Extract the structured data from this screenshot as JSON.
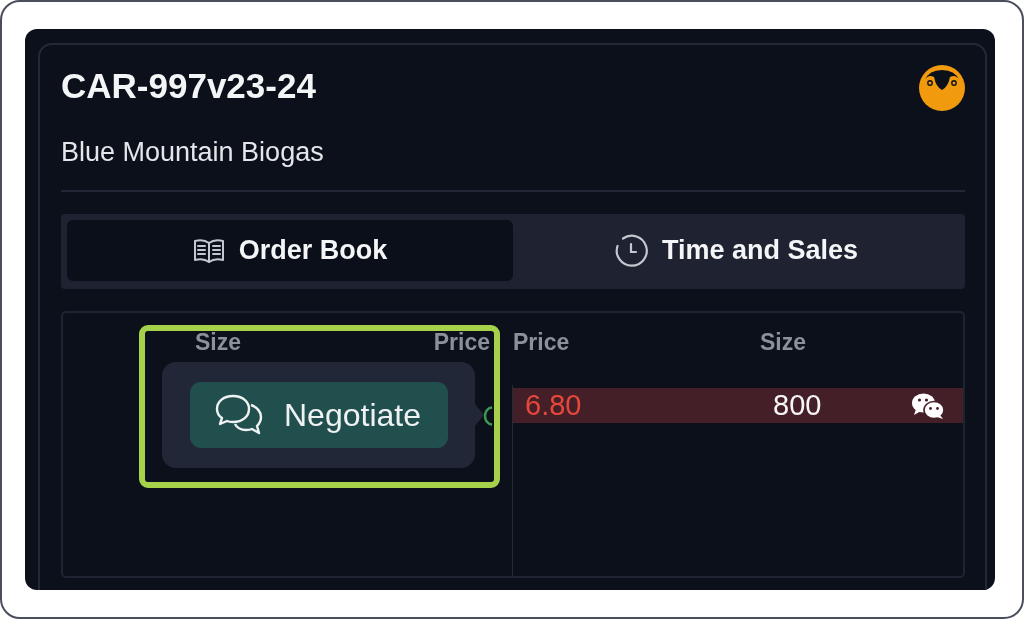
{
  "instrument": {
    "code": "CAR-997v23-24",
    "name": "Blue Mountain Biogas"
  },
  "tabs": [
    {
      "label": "Order Book",
      "selected": true
    },
    {
      "label": "Time and Sales",
      "selected": false
    }
  ],
  "order_book": {
    "bids": {
      "columns": [
        "Size",
        "Price"
      ]
    },
    "asks": {
      "columns": [
        "Price",
        "Size"
      ],
      "rows": [
        {
          "price": "6.80",
          "size": "800"
        }
      ]
    }
  },
  "popover": {
    "button": "Negotiate",
    "highlighted": true
  }
}
